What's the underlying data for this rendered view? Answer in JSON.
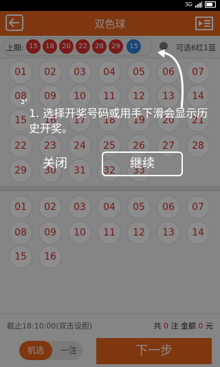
{
  "header": {
    "title": "双色球"
  },
  "history": {
    "label": "上期:",
    "red_balls": [
      "15",
      "18",
      "20",
      "22",
      "28",
      "29"
    ],
    "blue_ball": "15",
    "rule_text": "可选6红1蓝"
  },
  "red_section": {
    "numbers": [
      "01",
      "02",
      "03",
      "04",
      "05",
      "06",
      "07",
      "08",
      "09",
      "10",
      "11",
      "12",
      "13",
      "14",
      "15",
      "16",
      "17",
      "18",
      "19",
      "20",
      "21",
      "22",
      "23",
      "24",
      "25",
      "26",
      "27",
      "28",
      "29",
      "30",
      "31",
      "32",
      "33"
    ]
  },
  "blue_section": {
    "numbers": [
      "01",
      "02",
      "03",
      "04",
      "05",
      "06",
      "07",
      "08",
      "09",
      "10",
      "11",
      "12",
      "13",
      "14",
      "15",
      "16"
    ]
  },
  "footer": {
    "deadline": "截止18:10:00(双击设胆)",
    "summary_prefix": "共",
    "count": "0",
    "summary_mid": "注 金额",
    "amount": "0",
    "summary_suffix": "元"
  },
  "bottom": {
    "mode_quick": "机选",
    "mode_single": "一注",
    "next_label": "下一步"
  },
  "guide": {
    "text": "1. 选择开奖号码或用手下滑会显示历史开奖。",
    "close_label": "关闭",
    "continue_label": "继续"
  },
  "colors": {
    "accent": "#e8641e",
    "red_ball": "#d9302c",
    "blue_ball": "#2c7fd6"
  }
}
